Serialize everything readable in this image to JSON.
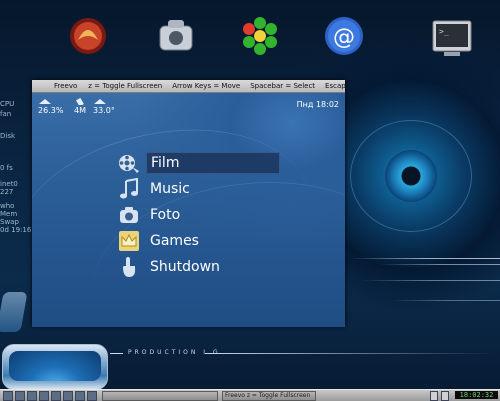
{
  "desktop": {
    "icons": [
      {
        "name": "phoenix-icon"
      },
      {
        "name": "camera-icon"
      },
      {
        "name": "icq-flower-icon"
      },
      {
        "name": "at-mail-icon"
      },
      {
        "name": "terminal-icon",
        "glyph": ">_"
      }
    ],
    "conky": [
      "",
      "",
      "",
      "",
      "",
      "",
      "",
      "",
      "",
      "CPU",
      "fan",
      "",
      "Disk",
      "",
      "0 fs",
      "",
      "inet0",
      "",
      "227",
      "",
      "",
      "who",
      "Mem",
      "Swap",
      "0d 19:16"
    ]
  },
  "freevo_window": {
    "title": "Freevo",
    "hints": [
      "z = Toggle Fullscreen",
      "Arrow Keys = Move",
      "Spacebar = Select",
      "Escape = Stop/Pre..."
    ],
    "status": {
      "cpu": "26.3%",
      "mem": "4M",
      "temp": "33.0°",
      "clock": "Пнд 18:02"
    },
    "menu": [
      {
        "label": "Film",
        "icon": "film-reel-icon",
        "selected": true
      },
      {
        "label": "Music",
        "icon": "music-note-icon",
        "selected": false
      },
      {
        "label": "Foto",
        "icon": "camera-icon",
        "selected": false
      },
      {
        "label": "Games",
        "icon": "crown-icon",
        "selected": false
      },
      {
        "label": "Shutdown",
        "icon": "hand-icon",
        "selected": false
      }
    ]
  },
  "wallpaper": {
    "production_text": "PRODUCTION I.G."
  },
  "taskbar": {
    "tasks": [
      "",
      "Freevo ",
      "z = Toggle Fullscreen"
    ],
    "clock": "18:02:32"
  },
  "colors": {
    "accent": "#2c5f98",
    "taskbar": "#b0b0b0",
    "clock_text": "#6fd06f"
  }
}
